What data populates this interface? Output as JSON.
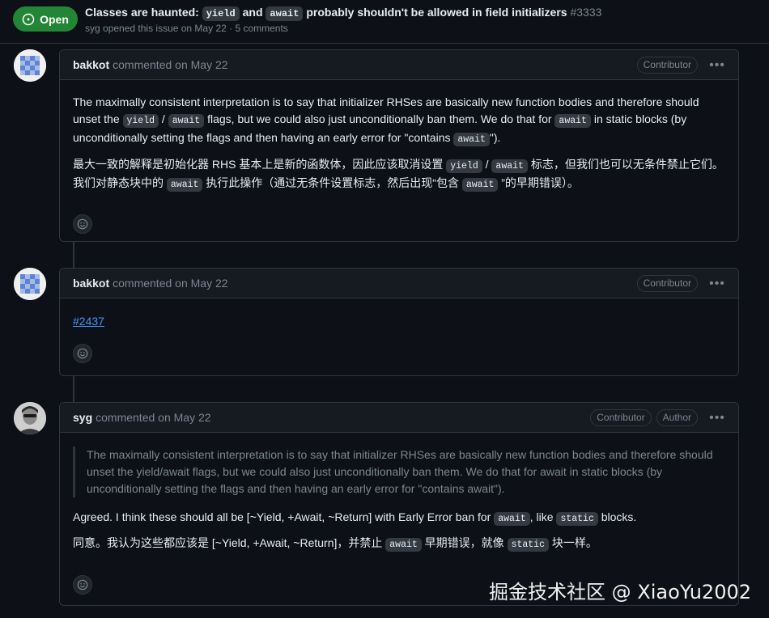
{
  "issue": {
    "status": "Open",
    "title_part1": "Classes are haunted: ",
    "title_code1": "yield",
    "title_part2": " and ",
    "title_code2": "await",
    "title_part3": " probably shouldn't be allowed in field initializers",
    "number": "#3333",
    "meta_author": "syg",
    "meta_rest": " opened this issue on May 22 · 5 comments"
  },
  "comments": [
    {
      "author": "bakkot",
      "timestamp": "commented on May 22",
      "badges": [
        "Contributor"
      ],
      "en": {
        "t1": "The maximally consistent interpretation is to say that initializer RHSes are basically new function bodies and therefore should unset the ",
        "c1": "yield",
        "t2": " / ",
        "c2": "await",
        "t3": " flags, but we could also just unconditionally ban them. We do that for ",
        "c3": "await",
        "t4": " in static blocks (by unconditionally setting the flags and then having an early error for \"contains ",
        "c4": "await",
        "t5": "\")."
      },
      "zh": {
        "t1": "最大一致的解释是初始化器 RHS 基本上是新的函数体，因此应该取消设置 ",
        "c1": "yield",
        "t2": " / ",
        "c2": "await",
        "t3": " 标志，但我们也可以无条件禁止它们。我们对静态块中的 ",
        "c3": "await",
        "t4": " 执行此操作（通过无条件设置标志，然后出现“包含 ",
        "c4": "await",
        "t5": " ”的早期错误）。"
      }
    },
    {
      "author": "bakkot",
      "timestamp": "commented on May 22",
      "badges": [
        "Contributor"
      ],
      "link": "#2437"
    },
    {
      "author": "syg",
      "timestamp": "commented on May 22",
      "badges": [
        "Contributor",
        "Author"
      ],
      "quote": "The maximally consistent interpretation is to say that initializer RHSes are basically new function bodies and therefore should unset the yield/await flags, but we could also just unconditionally ban them. We do that for await in static blocks (by unconditionally setting the flags and then having an early error for \"contains await\").",
      "en": {
        "t1": "Agreed. I think these should all be [~Yield, +Await, ~Return] with Early Error ban for ",
        "c1": "await",
        "t2": ", like ",
        "c2": "static",
        "t3": " blocks."
      },
      "zh": {
        "t1": "同意。我认为这些都应该是 [~Yield, +Await, ~Return]，并禁止 ",
        "c1": "await",
        "t2": " 早期错误，就像 ",
        "c2": "static",
        "t3": " 块一样。"
      }
    }
  ],
  "more_icon": "kebab-horizontal-icon",
  "reaction_icon": "smiley-icon",
  "watermark": "掘金技术社区 @ XiaoYu2002",
  "colors": {
    "open_green": "#238636",
    "link": "#4493f8",
    "bg": "#0d1117"
  }
}
